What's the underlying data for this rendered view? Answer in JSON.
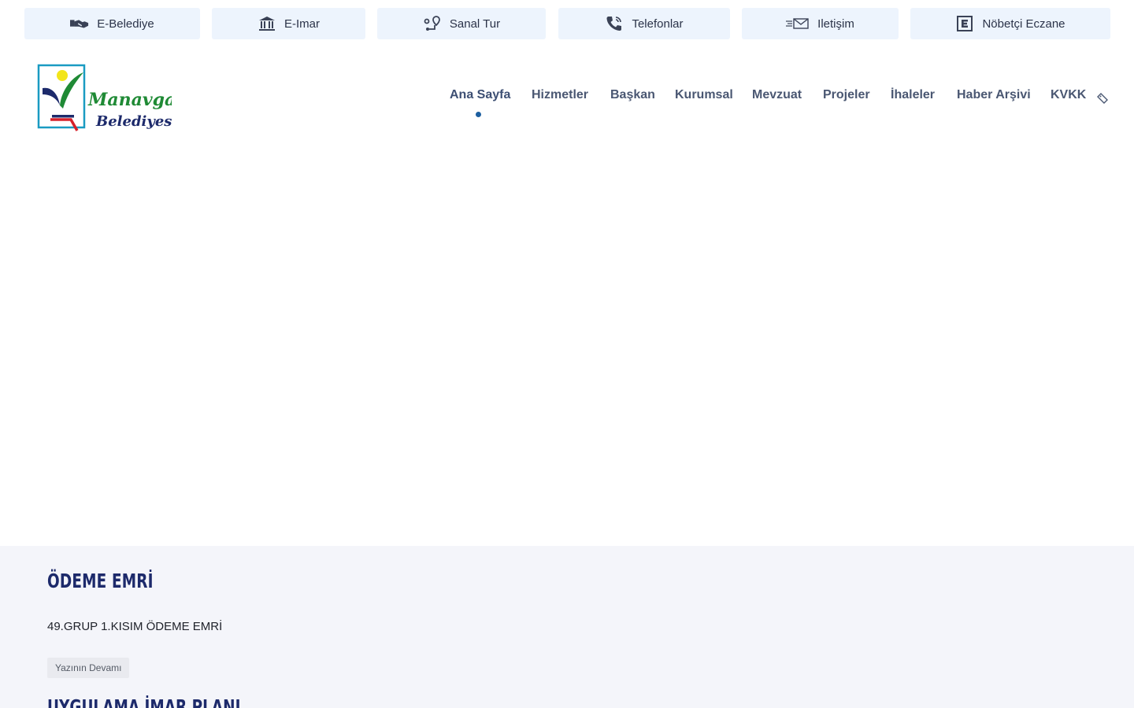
{
  "quick_links": [
    {
      "label": "E-Belediye",
      "icon": "handshake-icon"
    },
    {
      "label": "E-Imar",
      "icon": "bank-building-icon"
    },
    {
      "label": "Sanal Tur",
      "icon": "route-pin-icon"
    },
    {
      "label": "Telefonlar",
      "icon": "phone-icon"
    },
    {
      "label": "Iletişim",
      "icon": "envelope-icon"
    },
    {
      "label": "Nöbetçi Eczane",
      "icon": "pharmacy-e-icon"
    }
  ],
  "logo": {
    "line1": "Manavgat",
    "line2": "Belediyesi"
  },
  "nav": {
    "items": [
      "Ana Sayfa",
      "Hizmetler",
      "Başkan",
      "Kurumsal",
      "Mevzuat",
      "Projeler",
      "İhaleler",
      "Haber Arşivi",
      "KVKK"
    ],
    "active": "Ana Sayfa"
  },
  "news": {
    "title": "ÖDEME EMRİ",
    "text": "49.GRUP 1.KISIM ÖDEME EMRİ",
    "read_more": "Yazının Devamı",
    "next_title": "UYGULAMA İMAR PLANI"
  },
  "colors": {
    "accent": "#1d5fa0",
    "heading": "#1d2a6b",
    "quick_bg": "#edf4fd",
    "news_bg": "#f4f5fa"
  }
}
